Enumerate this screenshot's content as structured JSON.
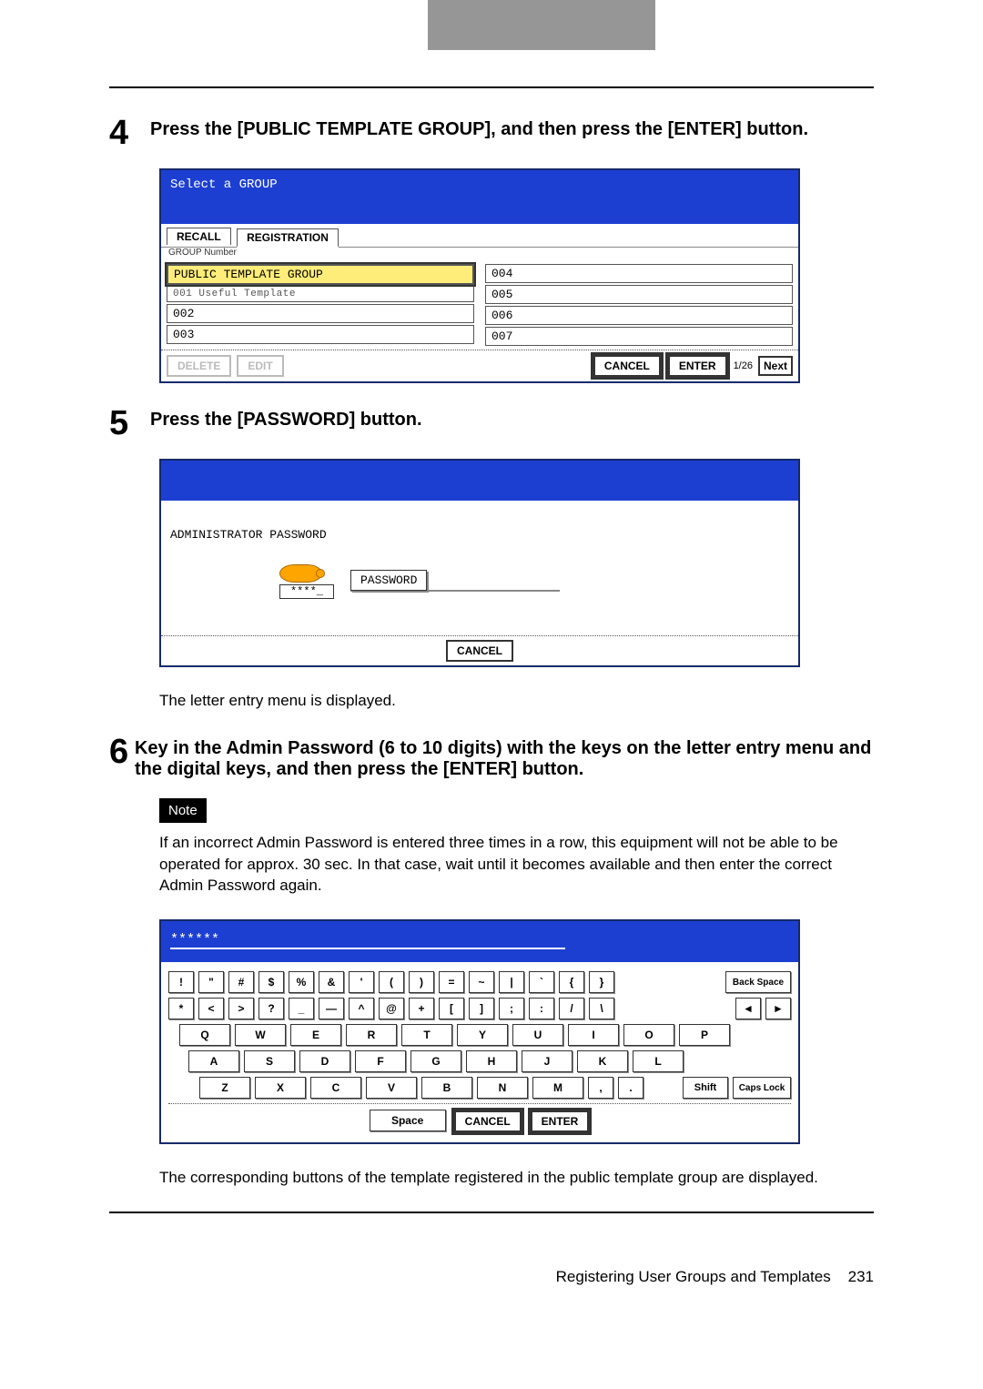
{
  "step4": {
    "num": "4",
    "title": "Press the [PUBLIC TEMPLATE GROUP], and then press the [ENTER] button.",
    "ui": {
      "header": "Select a GROUP",
      "tab_recall": "RECALL",
      "tab_registration": "REGISTRATION",
      "sublabel": "GROUP Number",
      "left_items": [
        "PUBLIC TEMPLATE GROUP",
        "001 Useful Template",
        "002",
        "003"
      ],
      "right_items": [
        "004",
        "005",
        "006",
        "007"
      ],
      "btn_delete": "DELETE",
      "btn_edit": "EDIT",
      "btn_cancel": "CANCEL",
      "btn_enter": "ENTER",
      "page": "1/26",
      "btn_next": "Next"
    }
  },
  "step5": {
    "num": "5",
    "title": "Press the [PASSWORD] button.",
    "ui": {
      "label": "ADMINISTRATOR PASSWORD",
      "masked": "****_",
      "btn_password": "PASSWORD",
      "btn_cancel": "CANCEL"
    },
    "after": "The letter entry menu is displayed."
  },
  "step6": {
    "num": "6",
    "title": "Key in the Admin Password (6 to 10 digits) with the keys on the letter entry menu and the digital keys, and then press the [ENTER] button.",
    "note_label": "Note",
    "note_text": "If an incorrect Admin Password is entered three times in a row, this equipment will not be able to be operated for approx. 30 sec. In that case, wait until it becomes available and then enter the correct Admin Password again.",
    "ui": {
      "entered": "******",
      "row1": [
        "!",
        "\"",
        "#",
        "$",
        "%",
        "&",
        "'",
        "(",
        ")",
        "=",
        "~",
        "|",
        "`",
        "{",
        "}"
      ],
      "backspace": "Back Space",
      "row2": [
        "*",
        "<",
        ">",
        "?",
        "_",
        "—",
        "^",
        "@",
        "+",
        "[",
        "]",
        ";",
        ":",
        "/",
        "\\"
      ],
      "arrows": [
        "◄",
        "►"
      ],
      "row3": [
        "Q",
        "W",
        "E",
        "R",
        "T",
        "Y",
        "U",
        "I",
        "O",
        "P"
      ],
      "row4": [
        "A",
        "S",
        "D",
        "F",
        "G",
        "H",
        "J",
        "K",
        "L"
      ],
      "row5": [
        "Z",
        "X",
        "C",
        "V",
        "B",
        "N",
        "M",
        ",",
        "."
      ],
      "shift": "Shift",
      "capslock": "Caps Lock",
      "space": "Space",
      "cancel": "CANCEL",
      "enter": "ENTER"
    },
    "after": "The corresponding buttons of the template registered in the public template group are displayed."
  },
  "footer": {
    "text": "Registering User Groups and Templates",
    "page": "231"
  }
}
